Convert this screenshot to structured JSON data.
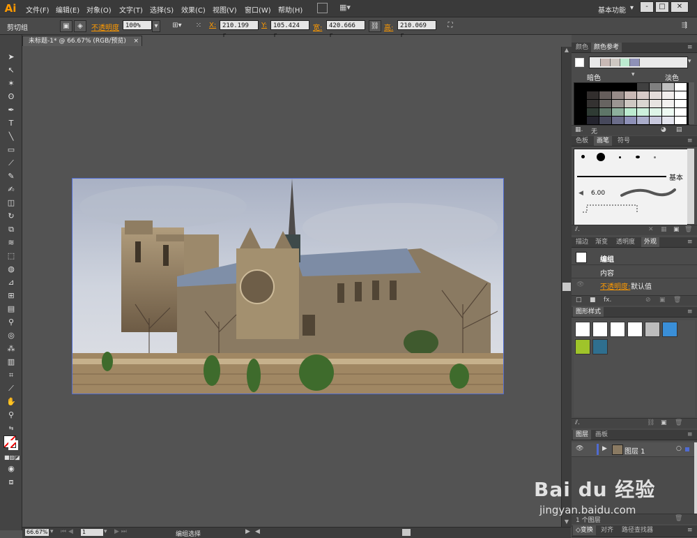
{
  "app": {
    "logo": "Ai",
    "workspace": "基本功能"
  },
  "menus": [
    "文件(F)",
    "编辑(E)",
    "对象(O)",
    "文字(T)",
    "选择(S)",
    "效果(C)",
    "视图(V)",
    "窗口(W)",
    "帮助(H)"
  ],
  "window_controls": [
    "-",
    "□",
    "✕"
  ],
  "control": {
    "selection": "剪切组",
    "opacity_label": "不透明度",
    "opacity_value": "100%",
    "x_label": "X:",
    "x_value": "210.199 r",
    "y_label": "Y:",
    "y_value": "105.424 r",
    "w_label": "宽:",
    "w_value": "420.666 r",
    "h_label": "高:",
    "h_value": "210.069 r"
  },
  "document": {
    "tab_title": "未标题-1* @ 66.67% (RGB/预览)"
  },
  "status": {
    "zoom": "66.67%",
    "page": "1",
    "mode": "编组选择"
  },
  "color_panel": {
    "tabs": [
      "颜色",
      "颜色参考"
    ],
    "darker": "暗色",
    "lighter": "淡色",
    "none_label": "无",
    "guide_colors": [
      "#e8e8e8",
      "#c9b9b5",
      "#cec8c2",
      "#bcebd0",
      "#8e91b8"
    ]
  },
  "brush_panel": {
    "tabs": [
      "色板",
      "画笔",
      "符号"
    ],
    "basic": "基本",
    "size": "6.00"
  },
  "appearance_panel": {
    "tabs": [
      "描边",
      "渐变",
      "透明度",
      "外观"
    ],
    "group": "编组",
    "contents": "内容",
    "opacity": "不透明度:",
    "default": "默认值"
  },
  "styles_panel": {
    "tabs": [
      "图形样式"
    ]
  },
  "layers_panel": {
    "tabs": [
      "图层",
      "画板"
    ],
    "layer_name": "图层 1",
    "footer_count": "1 个图层"
  },
  "bottom_tabs": [
    "变换",
    "对齐",
    "路径查找器"
  ],
  "watermark": {
    "brand": "Bai du 经验",
    "url": "jingyan.baidu.com"
  }
}
